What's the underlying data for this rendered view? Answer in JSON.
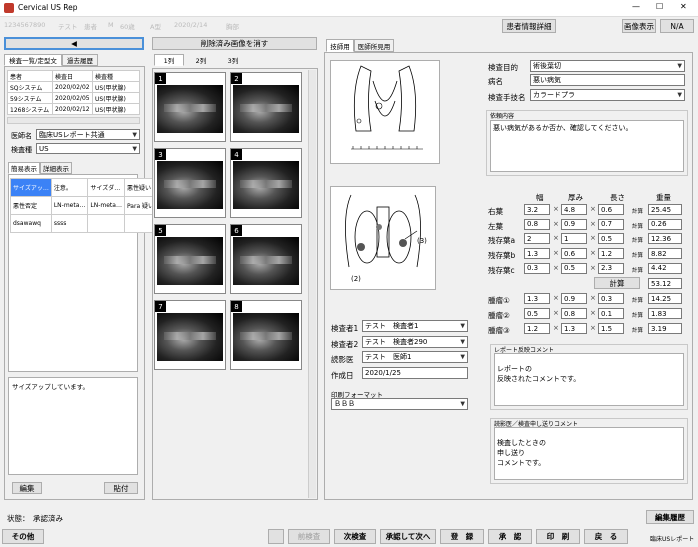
{
  "window": {
    "title": "Cervical US Rep",
    "controls": [
      "—",
      "☐",
      "✕"
    ]
  },
  "patient_bar": [
    "1234567890",
    "テスト",
    "患者",
    "M",
    "60歳",
    "A型",
    "2020/2/14",
    "胸部"
  ],
  "header_buttons": {
    "patient_info": "患者情報詳細",
    "image_display": "画像表示",
    "na": "N/A"
  },
  "left": {
    "back_arrow": "◀",
    "tabs": [
      "検査一覧/定型文",
      "過去履歴"
    ],
    "list_headers": [
      "患者",
      "検査日",
      "検査種"
    ],
    "list_rows": [
      [
        "SQシステム",
        "2020/02/02",
        "US(甲状腺)"
      ],
      [
        "59システム",
        "2020/02/05",
        "US(甲状腺)"
      ],
      [
        "1268システム",
        "2020/02/12",
        "US(甲状腺)"
      ]
    ],
    "doctor_label": "医師名",
    "doctor_value": "臨床USレポート共通",
    "exam_type_label": "検査種",
    "exam_type_value": "US",
    "sub_tabs": [
      "簡易表示",
      "詳細表示"
    ],
    "grid": [
      [
        "サイズアッ…",
        "注意。",
        "サイズダ…",
        "悪性疑い"
      ],
      [
        "悪性否定",
        "LN-meta…",
        "LN-meta…",
        "Para 疑い"
      ],
      [
        "dsawawq",
        "ssss",
        "",
        ""
      ]
    ],
    "memo": "サイズアップしています。",
    "edit_button": "編集",
    "paste_button": "貼付"
  },
  "middle": {
    "delete_button": "削除済み画像を消す",
    "col_tabs": [
      "1列",
      "2列",
      "3列"
    ],
    "thumbs": [
      "1",
      "2",
      "3",
      "4",
      "5",
      "6",
      "7",
      "8"
    ]
  },
  "right": {
    "tabs": [
      "技師用",
      "医師所見用"
    ],
    "purpose_label": "検査目的",
    "purpose_value": "術後葉切",
    "disease_label": "病名",
    "disease_value": "悪い病気",
    "technique_label": "検査手技名",
    "technique_value": "カラードプラ",
    "request_label": "依頼内容",
    "request_text": "悪い病気があるか否か、確認してください。",
    "col_headers": [
      "幅",
      "厚み",
      "長さ",
      "重量"
    ],
    "rows": [
      {
        "label": "右葉",
        "w": "3.2",
        "t": "4.8",
        "l": "0.6",
        "calc": "計算",
        "weight": "25.45"
      },
      {
        "label": "左葉",
        "w": "0.8",
        "t": "0.9",
        "l": "0.7",
        "calc": "計算",
        "weight": "0.26"
      },
      {
        "label": "残存葉a",
        "w": "2",
        "t": "1",
        "l": "0.5",
        "calc": "計算",
        "weight": "12.36"
      },
      {
        "label": "残存葉b",
        "w": "1.3",
        "t": "0.6",
        "l": "1.2",
        "calc": "計算",
        "weight": "8.82"
      },
      {
        "label": "残存葉c",
        "w": "0.3",
        "t": "0.5",
        "l": "2.3",
        "calc": "計算",
        "weight": "4.42"
      }
    ],
    "total_button": "計算",
    "total_value": "53.12",
    "tumors": [
      {
        "label": "腫瘤①",
        "w": "1.3",
        "t": "0.9",
        "l": "0.3",
        "calc": "計算",
        "weight": "14.25"
      },
      {
        "label": "腫瘤②",
        "w": "0.5",
        "t": "0.8",
        "l": "0.1",
        "calc": "計算",
        "weight": "1.83"
      },
      {
        "label": "腫瘤③",
        "w": "1.2",
        "t": "1.3",
        "l": "1.5",
        "calc": "計算",
        "weight": "3.19"
      }
    ],
    "examiner1_label": "検査者1",
    "examiner1_value": "テスト　検査者1",
    "examiner2_label": "検査者2",
    "examiner2_value": "テスト　検査者290",
    "reader_label": "読影医",
    "reader_value": "テスト　医師1",
    "created_label": "作成日",
    "created_value": "2020/1/25",
    "format_label": "印刷フォーマット",
    "format_value": "ＢＢＢ",
    "report_comment_label": "レポート反映コメント",
    "report_comment": "レポートの\n反映されたコメントです。",
    "handover_label": "読影医／検査申し送りコメント",
    "handover": "検査したときの\n申し送り\nコメントです。",
    "diagram_labels": [
      "(3)",
      "(2)"
    ]
  },
  "status": {
    "label": "状態：",
    "value": "承認済み"
  },
  "history_button": "編集履歴",
  "bottom": {
    "other": "その他",
    "prev": "前検査",
    "next": "次検査",
    "approve_next": "承認して次へ",
    "register": "登　録",
    "approve": "承　認",
    "print": "印　刷",
    "back": "戻　る",
    "app_label": "臨床USレポート"
  }
}
